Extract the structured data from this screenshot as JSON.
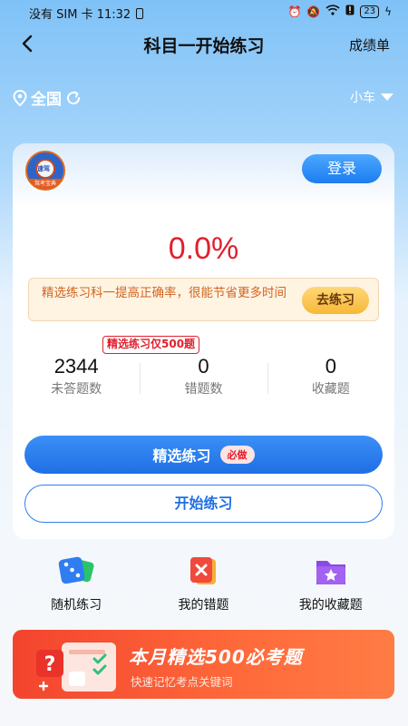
{
  "status_bar": {
    "left_text": "没有 SIM 卡 11:32",
    "battery_level": "23"
  },
  "nav": {
    "title": "科目一开始练习",
    "right_label": "成绩单"
  },
  "region": {
    "label": "全国",
    "vehicle": "小车"
  },
  "card": {
    "logo_text": "速驾",
    "logo_band": "驾考宝典",
    "login_label": "登录",
    "accuracy": "0.0%",
    "tip_text": "精选练习科一提高正确率，很能节省更多时间",
    "tip_button": "去练习",
    "badge": "精选练习仅500题",
    "stats": [
      {
        "value": "2344",
        "label": "未答题数"
      },
      {
        "value": "0",
        "label": "错题数"
      },
      {
        "value": "0",
        "label": "收藏题"
      }
    ],
    "primary_button": "精选练习",
    "primary_tag": "必做",
    "secondary_button": "开始练习"
  },
  "quick_actions": [
    {
      "label": "随机练习",
      "icon": "dice-icon"
    },
    {
      "label": "我的错题",
      "icon": "wrong-questions-icon"
    },
    {
      "label": "我的收藏题",
      "icon": "favorites-folder-icon"
    }
  ],
  "banner": {
    "title": "本月精选500必考题",
    "subtitle": "快速记忆考点关键词"
  }
}
